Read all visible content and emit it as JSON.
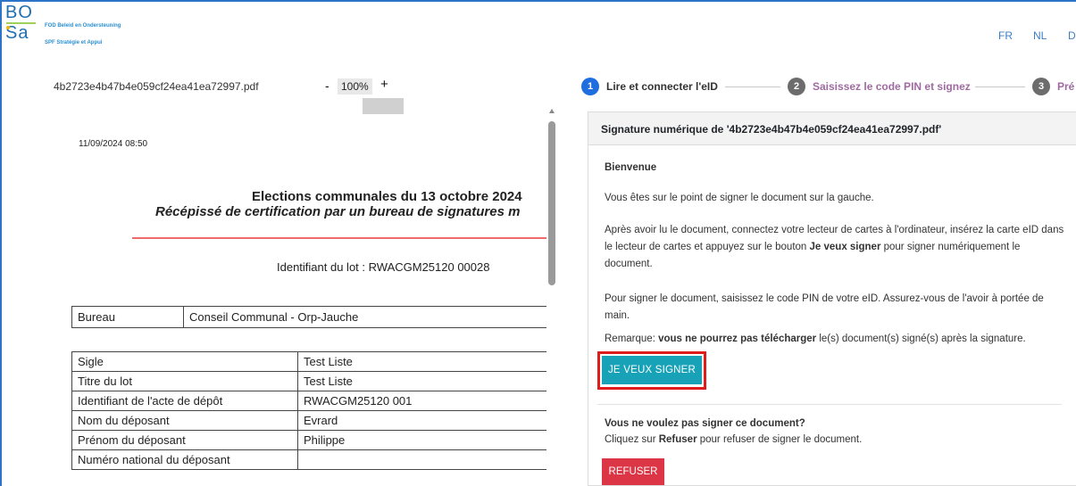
{
  "header": {
    "logo_line1": "BO",
    "logo_line2": "Sa",
    "org_nl": "FOD Beleid en Ondersteuning",
    "org_fr": "SPF Stratégie et Appui",
    "languages": [
      "FR",
      "NL",
      "D"
    ]
  },
  "viewer": {
    "filename": "4b2723e4b47b4e059cf24ea41ea72997.pdf",
    "zoom_minus": "-",
    "zoom_value": "100%",
    "zoom_plus": "+",
    "document": {
      "datetime": "11/09/2024 08:50",
      "title": "Elections communales du 13 octobre 2024",
      "subtitle": "Récépissé de certification par un bureau de signatures m",
      "lot_label": "Identifiant du lot : RWACGM25120 00028",
      "bureau_table": [
        [
          "Bureau",
          "Conseil Communal - Orp-Jauche"
        ]
      ],
      "details_table": [
        [
          "Sigle",
          "Test Liste"
        ],
        [
          "Titre du lot",
          "Test Liste"
        ],
        [
          "Identifiant de l'acte de dépôt",
          "RWACGM25120 001"
        ],
        [
          "Nom du déposant",
          "Evrard"
        ],
        [
          "Prénom du déposant",
          "Philippe"
        ],
        [
          "Numéro national du déposant",
          ""
        ]
      ]
    }
  },
  "stepper": {
    "steps": [
      {
        "number": "1",
        "label": "Lire et connecter l'eID"
      },
      {
        "number": "2",
        "label": "Saisissez le code PIN et signez"
      },
      {
        "number": "3",
        "label": "Pré"
      }
    ]
  },
  "card": {
    "title": "Signature numérique de '4b2723e4b47b4e059cf24ea41ea72997.pdf'",
    "welcome": "Bienvenue",
    "p1": "Vous êtes sur le point de signer le document sur la gauche.",
    "p2_before": "Après avoir lu le document, connectez votre lecteur de cartes à l'ordinateur, insérez la carte eID dans le lecteur de cartes et appuyez sur le bouton ",
    "p2_bold": "Je veux signer",
    "p2_after": " pour signer numériquement le document.",
    "p3": "Pour signer le document, saisissez le code PIN de votre eID. Assurez-vous de l'avoir à portée de main.",
    "p4_before": "Remarque: ",
    "p4_bold": "vous ne pourrez pas télécharger",
    "p4_after": " le(s) document(s) signé(s) après la signature.",
    "sign_button": "JE VEUX SIGNER",
    "no_sign_title": "Vous ne voulez pas signer ce document?",
    "no_sign_before": "Cliquez sur ",
    "no_sign_bold": "Refuser",
    "no_sign_after": " pour refuser de signer le document.",
    "refuse_button": "REFUSER"
  },
  "colors": {
    "accent_blue": "#1e6ee0",
    "sign_button": "#17a2b8",
    "refuse_button": "#dc3545",
    "highlight_outline": "#e01b1b",
    "doc_rule": "#ef6a6a"
  }
}
